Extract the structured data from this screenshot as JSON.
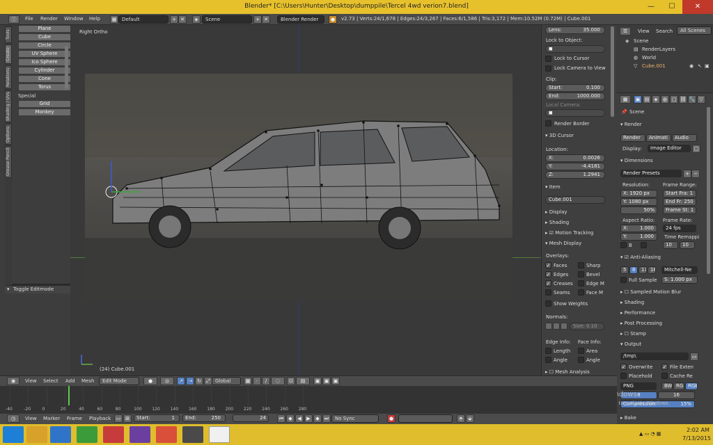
{
  "window": {
    "title": "Blender* [C:\\Users\\Hunter\\Desktop\\dumppile\\Tercel 4wd verion7.blend]",
    "minimize": "—",
    "maximize": "☐",
    "close": "✕"
  },
  "menu": {
    "items": [
      "File",
      "Render",
      "Window",
      "Help"
    ],
    "layout": "Default",
    "scene": "Scene",
    "engine": "Blender Render",
    "stats": "v2.73 | Verts:24/1,678 | Edges:24/3,267 | Faces:6/1,586 | Tris:3,172 | Mem:10.52M (0.72M) | Cube.001"
  },
  "toolshelf": {
    "tabs": [
      "Tools",
      "Create",
      "Relations",
      "Shading / UVs",
      "Options",
      "Grease Pencil"
    ],
    "primitives": [
      "Plane",
      "Cube",
      "Circle",
      "UV Sphere",
      "Ico Sphere",
      "Cylinder",
      "Cone",
      "Torus"
    ],
    "special_label": "Special",
    "special": [
      "Grid",
      "Monkey"
    ],
    "toggle_editmode": "Toggle Editmode"
  },
  "viewport": {
    "view_label": "Right Ortho",
    "object_label": "(24) Cube.001"
  },
  "npanel": {
    "lens": "Lens:",
    "lens_val": "35.000",
    "lock_object": "Lock to Object:",
    "lock_cursor": "Lock to Cursor",
    "lock_camera": "Lock Camera to View",
    "clip": "Clip:",
    "clip_start": "Start:",
    "clip_start_val": "0.100",
    "clip_end": "End:",
    "clip_end_val": "1000.000",
    "local_camera": "Local Camera:",
    "render_border": "Render Border",
    "cursor_section": "3D Cursor",
    "location": "Location:",
    "cx": "X:",
    "cx_val": "0.0026",
    "cy": "Y:",
    "cy_val": "-4.4181",
    "cz": "Z:",
    "cz_val": "1.2941",
    "item_section": "Item",
    "item_name": "Cube.001",
    "display": "Display",
    "shading": "Shading",
    "motion": "Motion Tracking",
    "mesh_display": "Mesh Display",
    "overlays": "Overlays:",
    "ov_faces": "Faces",
    "ov_sharp": "Sharp",
    "ov_edges": "Edges",
    "ov_bevel": "Bevel",
    "ov_creases": "Creases",
    "ov_edgem": "Edge M",
    "ov_seams": "Seams",
    "ov_facem": "Face M",
    "show_weights": "Show Weights",
    "normals": "Normals:",
    "size": "Size:",
    "size_val": "0.10",
    "edge_info": "Edge Info:",
    "face_info": "Face Info:",
    "length": "Length",
    "area": "Area",
    "angle": "Angle",
    "angle2": "Angle",
    "mesh_analysis": "Mesh Analysis"
  },
  "outliner": {
    "view": "View",
    "search": "Search",
    "all_scenes": "All Scenes",
    "scene": "Scene",
    "render_layers": "RenderLayers",
    "world": "World",
    "cube": "Cube.001"
  },
  "properties": {
    "scene": "Scene",
    "render": "Render",
    "btn_render": "Render",
    "btn_anim": "Animati",
    "btn_audio": "Audio",
    "display": "Display:",
    "display_val": "Image Editor",
    "dimensions": "Dimensions",
    "render_presets": "Render Presets",
    "resolution": "Resolution:",
    "frame_range": "Frame Range:",
    "resx": "X: 1920 px",
    "resy": "Y: 1080 px",
    "respct": "50%",
    "start_fr": "Start Fra: 1",
    "end_fr": "End Fr: 250",
    "frame_st": "Frame St: 1",
    "aspect": "Aspect Ratio:",
    "frame_rate": "Frame Rate:",
    "ax": "X:",
    "ax_val": "1.000",
    "ay": "Y:",
    "ay_val": "1.000",
    "fps": "24 fps",
    "time_remap": "Time Remappi",
    "remap_a": "10",
    "remap_b": "10",
    "b_label": "B",
    "anti_alias": "Anti-Aliasing",
    "aa": [
      "5",
      "8",
      "11",
      "16"
    ],
    "aa_filter": "Mitchell-Ne",
    "full_sample": "Full Sample",
    "aa_size": "S: 1.000 px",
    "motion_blur": "Sampled Motion Blur",
    "shading": "Shading",
    "performance": "Performance",
    "post": "Post Processing",
    "stamp": "Stamp",
    "output": "Output",
    "path": "/tmp\\",
    "overwrite": "Overwrite",
    "file_ext": "File Exten",
    "placeholders": "Placehold",
    "cache": "Cache Re",
    "format": "PNG",
    "bw": "BW",
    "rgb": "RGB",
    "rgba": "RGBA",
    "depth8": "8",
    "depth16": "16",
    "compression": "Compression:",
    "comp_val": "15%",
    "bake": "Bake",
    "activate": "Activate Windows",
    "activate_sub": "Go to PC settings to activate Windows."
  },
  "header3d": {
    "view": "View",
    "select": "Select",
    "add": "Add",
    "mesh": "Mesh",
    "mode": "Edit Mode",
    "orientation": "Global"
  },
  "timeline": {
    "ticks": [
      "-40",
      "-20",
      "0",
      "20",
      "40",
      "60",
      "80",
      "100",
      "120",
      "140",
      "160",
      "180",
      "200",
      "220",
      "240",
      "260",
      "280"
    ],
    "current": "24",
    "view": "View",
    "marker": "Marker",
    "frame": "Frame",
    "playback": "Playback",
    "start": "Start:",
    "start_val": "1",
    "end": "End:",
    "end_val": "250",
    "frame_val": "24",
    "sync": "No Sync"
  },
  "taskbar": {
    "time": "2:02 AM",
    "date": "7/13/2015"
  },
  "colors": {
    "accent": "#5680c2",
    "title": "#e7c12c",
    "mesh": "#111111"
  }
}
